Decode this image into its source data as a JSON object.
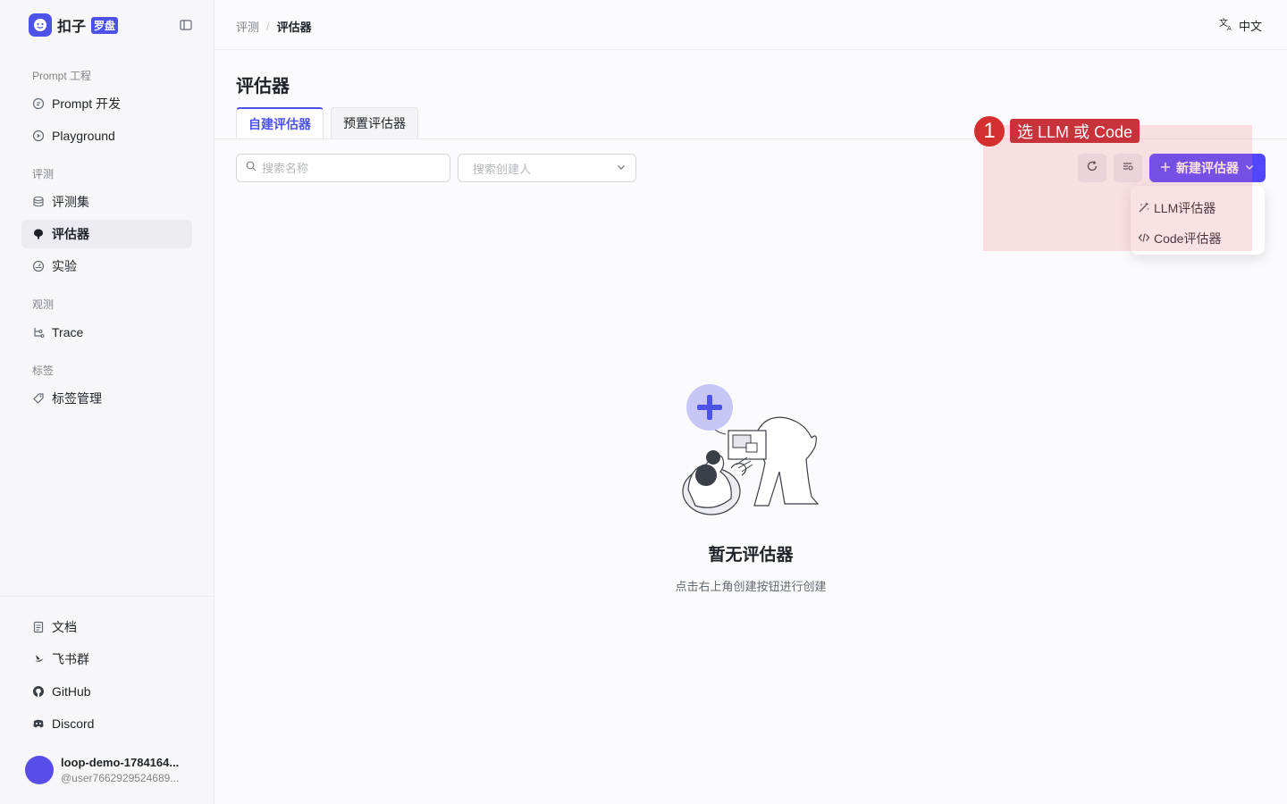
{
  "brand": {
    "name": "扣子",
    "tag": "罗盘"
  },
  "sidebar": {
    "groups": [
      {
        "title": "Prompt 工程",
        "items": [
          {
            "label": "Prompt 开发",
            "icon": "prompt-icon"
          },
          {
            "label": "Playground",
            "icon": "play-circle-icon"
          }
        ]
      },
      {
        "title": "评测",
        "items": [
          {
            "label": "评测集",
            "icon": "database-icon"
          },
          {
            "label": "评估器",
            "icon": "evaluator-icon",
            "active": true
          },
          {
            "label": "实验",
            "icon": "dashboard-icon"
          }
        ]
      },
      {
        "title": "观测",
        "items": [
          {
            "label": "Trace",
            "icon": "trace-icon"
          }
        ]
      },
      {
        "title": "标签",
        "items": [
          {
            "label": "标签管理",
            "icon": "tag-icon"
          }
        ]
      }
    ],
    "footer": [
      {
        "label": "文档",
        "icon": "doc-icon"
      },
      {
        "label": "飞书群",
        "icon": "feishu-icon"
      },
      {
        "label": "GitHub",
        "icon": "github-icon"
      },
      {
        "label": "Discord",
        "icon": "discord-icon"
      }
    ],
    "user": {
      "name": "loop-demo-1784164...",
      "handle": "@user7662929524689..."
    }
  },
  "header": {
    "breadcrumb": [
      "评测",
      "评估器"
    ],
    "language": "中文"
  },
  "main": {
    "title": "评估器",
    "tabs": [
      "自建评估器",
      "预置评估器"
    ],
    "search_placeholder": "搜索名称",
    "creator_placeholder": "搜索创建人",
    "new_button": "新建评估器",
    "dropdown": [
      "LLM评估器",
      "Code评估器"
    ],
    "empty": {
      "title": "暂无评估器",
      "subtitle": "点击右上角创建按钮进行创建"
    }
  },
  "annotation": {
    "number": "1",
    "label": "选 LLM 或 Code"
  },
  "colors": {
    "accent": "#5147ff",
    "annotation": "#d32f2f"
  }
}
